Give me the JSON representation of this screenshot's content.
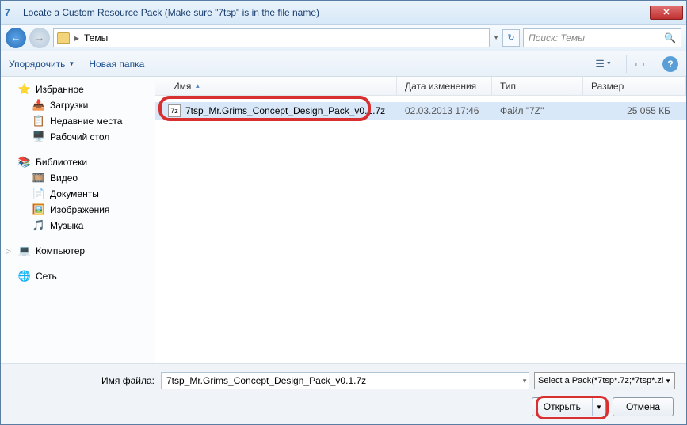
{
  "title": "Locate a Custom Resource Pack (Make sure \"7tsp\" is in the file name)",
  "breadcrumb": {
    "item": "Темы"
  },
  "search": {
    "placeholder": "Поиск: Темы"
  },
  "toolbar": {
    "organize": "Упорядочить",
    "newfolder": "Новая папка"
  },
  "sidebar": {
    "favorites": {
      "label": "Избранное",
      "downloads": "Загрузки",
      "recent": "Недавние места",
      "desktop": "Рабочий стол"
    },
    "libraries": {
      "label": "Библиотеки",
      "video": "Видео",
      "documents": "Документы",
      "pictures": "Изображения",
      "music": "Музыка"
    },
    "computer": {
      "label": "Компьютер"
    },
    "network": {
      "label": "Сеть"
    }
  },
  "columns": {
    "name": "Имя",
    "date": "Дата изменения",
    "type": "Тип",
    "size": "Размер"
  },
  "files": [
    {
      "name": "7tsp_Mr.Grims_Concept_Design_Pack_v0.1.7z",
      "date": "02.03.2013 17:46",
      "type": "Файл \"7Z\"",
      "size": "25 055 КБ"
    }
  ],
  "footer": {
    "filename_label": "Имя файла:",
    "filename_value": "7tsp_Mr.Grims_Concept_Design_Pack_v0.1.7z",
    "filter": "Select a Pack(*7tsp*.7z;*7tsp*.zi",
    "open": "Открыть",
    "cancel": "Отмена"
  }
}
